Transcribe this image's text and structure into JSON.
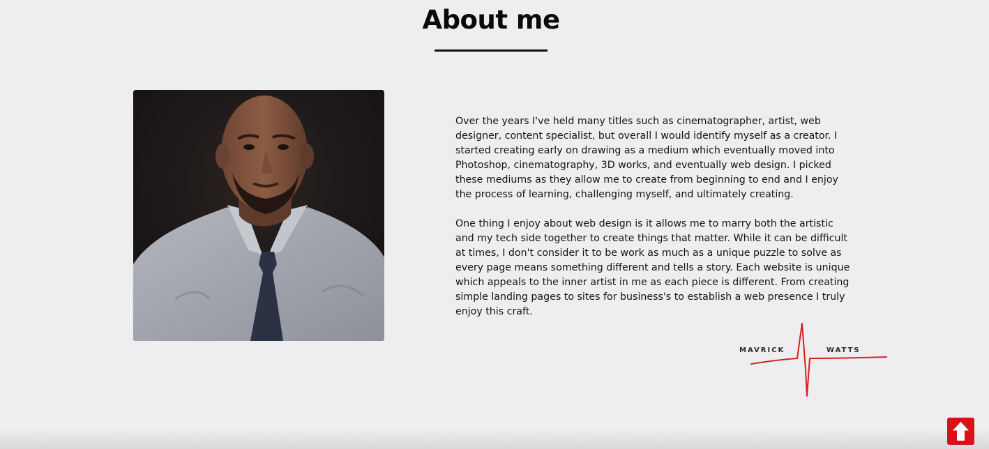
{
  "about": {
    "title": "About me",
    "paragraphs": [
      "Over the years I've held many titles such as cinematographer, artist, web designer, content specialist, but overall I would identify myself as a creator. I started creating early on drawing as a medium which eventually moved into Photoshop, cinematography, 3D works, and eventually web design. I picked these mediums as they allow me to create from beginning to end and I enjoy the process of learning, challenging myself, and ultimately creating.",
      "One thing I enjoy about web design is it allows me to marry both the artistic and my tech side together to create things that matter. While it can be difficult at times, I don't consider it to be work as much as a unique puzzle to solve as every page means something different and tells a story. Each website is unique which appeals to the inner artist in me as each piece is different. From creating simple landing pages to sites for business's to establish a web presence I truly enjoy this craft."
    ]
  },
  "signature": {
    "first_name": "MAVRICK",
    "last_name": "WATTS",
    "line_color": "#d9211c"
  },
  "scroll_top": {
    "icon": "arrow-up-icon",
    "color": "#d9111a"
  },
  "colors": {
    "background": "#eeedef",
    "text": "#141414",
    "accent": "#d9111a"
  }
}
